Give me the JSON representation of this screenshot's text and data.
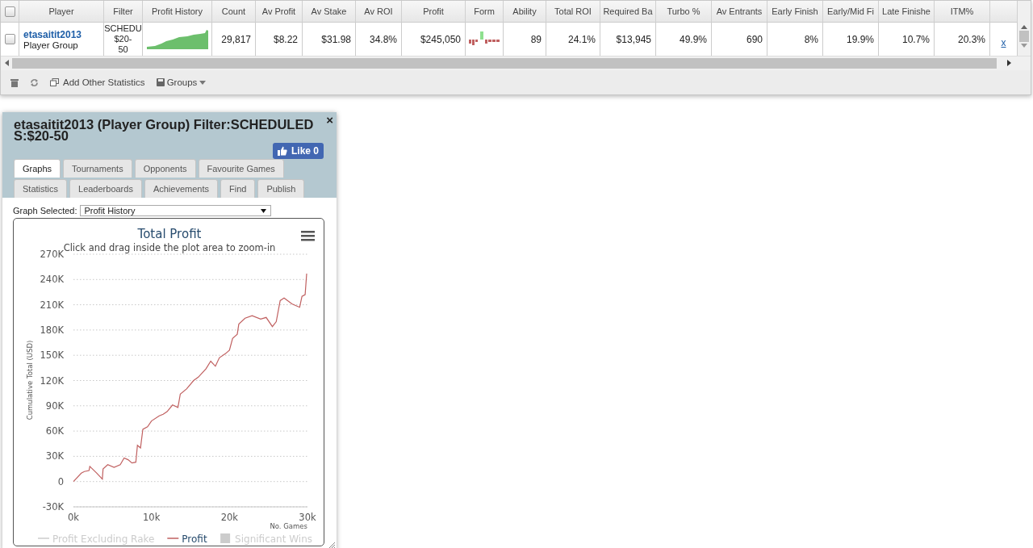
{
  "grid": {
    "select_all_checked": false,
    "columns": [
      "Player",
      "Filter",
      "Profit History",
      "Count",
      "Av Profit",
      "Av Stake",
      "Av ROI",
      "Profit",
      "Form",
      "Ability",
      "Total ROI",
      "Required Ba",
      "Turbo %",
      "Av Entrants",
      "Early Finish",
      "Early/Mid Fi",
      "Late Finishe",
      "ITM%"
    ],
    "rows": [
      {
        "checked": false,
        "player": "etasaitit2013",
        "player_type": "Player Group",
        "filter_lines": [
          "SCHEDU",
          "$20-",
          "50"
        ],
        "count": "29,817",
        "av_profit": "$8.22",
        "av_stake": "$31.98",
        "av_roi": "34.8%",
        "profit": "$245,050",
        "ability": "89",
        "total_roi": "24.1%",
        "required_bankroll": "$13,945",
        "turbo": "49.9%",
        "av_entrants": "690",
        "early_finish": "8%",
        "early_mid_finish": "19.9%",
        "late_finish": "10.7%",
        "itm": "20.3%",
        "remove": "x"
      }
    ],
    "toolbar": {
      "add_statistics": "Add Other Statistics",
      "groups": "Groups"
    }
  },
  "dialog": {
    "title": "etasaitit2013 (Player Group) Filter:SCHEDULED S:$20-50",
    "close": "×",
    "like": "Like 0",
    "tab_rows": [
      [
        {
          "label": "Graphs",
          "selected": true
        },
        {
          "label": "Tournaments",
          "selected": false
        },
        {
          "label": "Opponents",
          "selected": false
        },
        {
          "label": "Favourite Games",
          "selected": false
        }
      ],
      [
        {
          "label": "Statistics",
          "selected": false
        },
        {
          "label": "Leaderboards",
          "selected": false
        },
        {
          "label": "Achievements",
          "selected": false
        },
        {
          "label": "Find",
          "selected": false
        },
        {
          "label": "Publish",
          "selected": false
        }
      ]
    ],
    "graph_selected_label": "Graph Selected:",
    "graph_selected_value": "Profit History",
    "chart": {
      "subtitle": "Click and drag inside the plot area to zoom-in",
      "legend": [
        {
          "label": "Profit Excluding Rake",
          "kind": "line",
          "visible": false
        },
        {
          "kind": "series",
          "visible": true
        },
        {
          "label": "Significant Wins",
          "kind": "box",
          "visible": false
        }
      ],
      "chart_data": {
        "type": "line",
        "grid": true,
        "title": "Total Profit",
        "xlabel": "No. Games",
        "ylabel": "Cumulative Total (USD)",
        "x": [
          0,
          1000,
          1400,
          2000,
          2100,
          3000,
          3700,
          3800,
          4400,
          5200,
          6000,
          6500,
          7000,
          7500,
          8000,
          8200,
          8600,
          8900,
          9500,
          10000,
          11000,
          11500,
          12000,
          12700,
          13400,
          13700,
          14500,
          15400,
          16000,
          17000,
          17600,
          18200,
          18700,
          19500,
          20000,
          20400,
          21000,
          21200,
          22000,
          22900,
          24000,
          24700,
          25500,
          26000,
          26300,
          26500,
          27000,
          28000,
          29000,
          29300,
          29700,
          29900
        ],
        "series": [
          {
            "name": "Profit",
            "color": "#c06060",
            "values": [
              0,
              10000,
              12000,
              13000,
              18000,
              10000,
              3000,
              15000,
              20000,
              17000,
              20000,
              28000,
              26000,
              22000,
              23000,
              43000,
              40000,
              62000,
              65000,
              72000,
              78000,
              80000,
              83000,
              91000,
              88000,
              104000,
              110000,
              120000,
              124000,
              134000,
              143000,
              137000,
              147000,
              152000,
              156000,
              170000,
              175000,
              187000,
              194000,
              197000,
              193000,
              195000,
              184000,
              190000,
              205000,
              215000,
              218000,
              211000,
              207000,
              220000,
              222000,
              247000
            ]
          }
        ],
        "xlim": [
          0,
          30000
        ],
        "ylim": [
          -30000,
          270000
        ],
        "xticks": [
          {
            "value": 0,
            "label": "0k"
          },
          {
            "value": 10000,
            "label": "10k"
          },
          {
            "value": 20000,
            "label": "20k"
          },
          {
            "value": 30000,
            "label": "30k"
          }
        ],
        "yticks": [
          {
            "value": -30000,
            "label": "-30K"
          },
          {
            "value": 0,
            "label": "0"
          },
          {
            "value": 30000,
            "label": "30K"
          },
          {
            "value": 60000,
            "label": "60K"
          },
          {
            "value": 90000,
            "label": "90K"
          },
          {
            "value": 120000,
            "label": "120K"
          },
          {
            "value": 150000,
            "label": "150K"
          },
          {
            "value": 180000,
            "label": "180K"
          },
          {
            "value": 210000,
            "label": "210K"
          },
          {
            "value": 240000,
            "label": "240K"
          },
          {
            "value": 270000,
            "label": "270K"
          }
        ]
      }
    }
  }
}
